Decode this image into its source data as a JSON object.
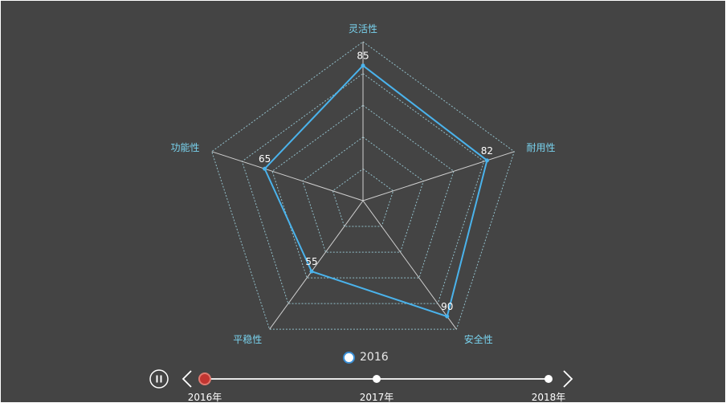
{
  "chart_data": {
    "type": "radar",
    "indicators": [
      {
        "name": "灵活性",
        "max": 100
      },
      {
        "name": "耐用性",
        "max": 100
      },
      {
        "name": "安全性",
        "max": 100
      },
      {
        "name": "平稳性",
        "max": 100
      },
      {
        "name": "功能性",
        "max": 100
      }
    ],
    "series": [
      {
        "name": "2016",
        "values": [
          85,
          82,
          90,
          55,
          65
        ],
        "color": "#4ab3ec"
      }
    ],
    "split_number": 5,
    "line_style": "dashed",
    "colors": {
      "background": "#444444",
      "split_line": "#9fd3e0",
      "axis_line": "#cfcfcf",
      "indicator_text": "#79d3ef",
      "value_text": "#ffffff"
    }
  },
  "legend": {
    "items": [
      "2016"
    ]
  },
  "timeline": {
    "labels": [
      "2016年",
      "2017年",
      "2018年"
    ],
    "current_index": 0,
    "playing": true,
    "active_color": "#c23531",
    "icons": {
      "play_pause": "pause-icon",
      "prev": "chevron-left-icon",
      "next": "chevron-right-icon"
    }
  }
}
